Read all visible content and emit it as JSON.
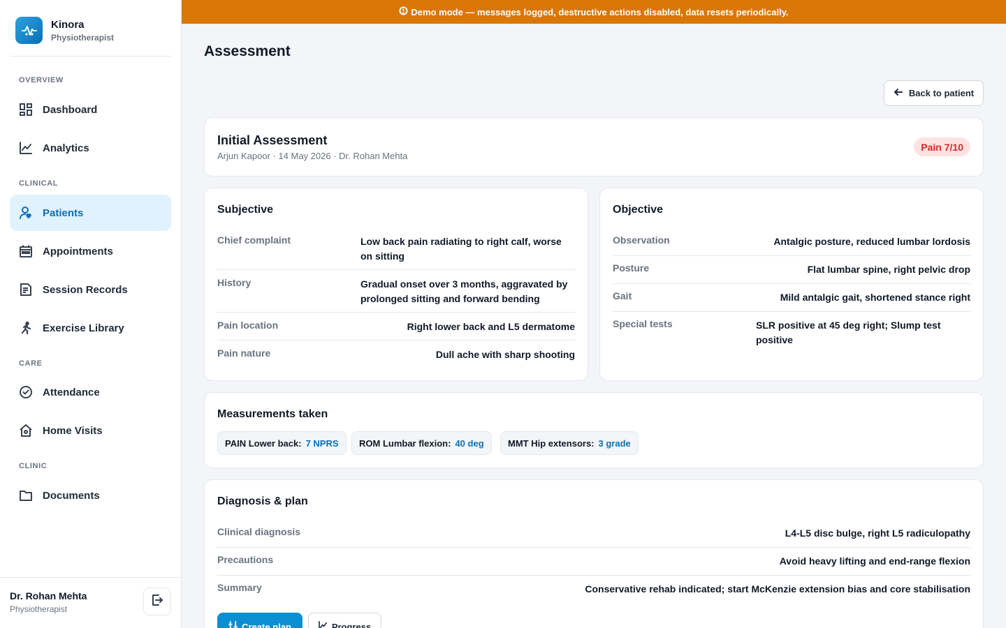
{
  "brand": {
    "name": "Kinora",
    "role": "Physiotherapist"
  },
  "nav": {
    "sections": {
      "overview": "OVERVIEW",
      "clinical": "CLINICAL",
      "care": "CARE",
      "clinic": "CLINIC"
    },
    "items": {
      "dashboard": "Dashboard",
      "analytics": "Analytics",
      "patients": "Patients",
      "appointments": "Appointments",
      "session_records": "Session Records",
      "exercise_library": "Exercise Library",
      "attendance": "Attendance",
      "home_visits": "Home Visits",
      "documents": "Documents"
    },
    "active": "patients"
  },
  "user": {
    "name": "Dr. Rohan Mehta",
    "role": "Physiotherapist"
  },
  "banner": {
    "text": "Demo mode — messages logged, destructive actions disabled, data resets periodically.",
    "color": "#d97706"
  },
  "page": {
    "title": "Assessment",
    "back_label": "Back to patient"
  },
  "assessment": {
    "title": "Initial Assessment",
    "meta": "Arjun Kapoor · 14 May 2026 · Dr. Rohan Mehta",
    "pain_badge": "Pain 7/10"
  },
  "subjective": {
    "title": "Subjective",
    "rows": [
      {
        "label": "Chief complaint",
        "value": "Low back pain radiating to right calf, worse on sitting"
      },
      {
        "label": "History",
        "value": "Gradual onset over 3 months, aggravated by prolonged sitting and forward bending"
      },
      {
        "label": "Pain location",
        "value": "Right lower back and L5 dermatome"
      },
      {
        "label": "Pain nature",
        "value": "Dull ache with sharp shooting"
      }
    ]
  },
  "objective": {
    "title": "Objective",
    "rows": [
      {
        "label": "Observation",
        "value": "Antalgic posture, reduced lumbar lordosis"
      },
      {
        "label": "Posture",
        "value": "Flat lumbar spine, right pelvic drop"
      },
      {
        "label": "Gait",
        "value": "Mild antalgic gait, shortened stance right"
      },
      {
        "label": "Special tests",
        "value": "SLR positive at 45 deg right; Slump test positive"
      }
    ]
  },
  "measurements": {
    "title": "Measurements taken",
    "chips": [
      {
        "label": "PAIN Lower back:",
        "value": "7 NPRS"
      },
      {
        "label": "ROM Lumbar flexion:",
        "value": "40 deg"
      },
      {
        "label": "MMT Hip extensors:",
        "value": "3 grade"
      }
    ]
  },
  "diagnosis": {
    "title": "Diagnosis & plan",
    "rows": [
      {
        "label": "Clinical diagnosis",
        "value": "L4-L5 disc bulge, right L5 radiculopathy"
      },
      {
        "label": "Precautions",
        "value": "Avoid heavy lifting and end-range flexion"
      },
      {
        "label": "Summary",
        "value": "Conservative rehab indicated; start McKenzie extension bias and core stabilisation"
      }
    ],
    "create_plan_label": "Create plan",
    "progress_label": "Progress"
  },
  "colors": {
    "accent": "#0b6fb6",
    "accent_bg": "#e0f2fe",
    "danger": "#dc2626",
    "danger_bg": "#fee2e2"
  }
}
